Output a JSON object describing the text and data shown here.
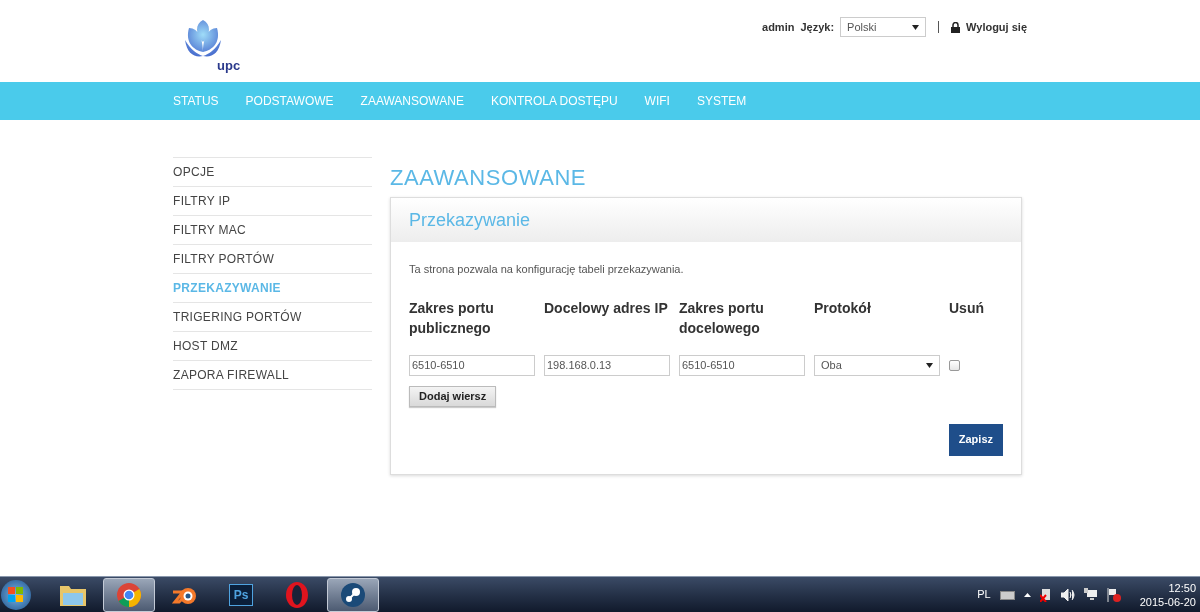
{
  "header": {
    "logo_text": "upc",
    "user": "admin",
    "language_label": "Język:",
    "language_select": {
      "value": "Polski"
    },
    "logout": "Wyloguj się"
  },
  "nav": [
    {
      "label": "STATUS",
      "selected": false
    },
    {
      "label": "PODSTAWOWE",
      "selected": false
    },
    {
      "label": "ZAAWANSOWANE",
      "selected": false
    },
    {
      "label": "KONTROLA DOSTĘPU",
      "selected": false
    },
    {
      "label": "WIFI",
      "selected": false
    },
    {
      "label": "SYSTEM",
      "selected": false
    }
  ],
  "sidebar": [
    {
      "label": "OPCJE",
      "selected": false
    },
    {
      "label": "FILTRY IP",
      "selected": false
    },
    {
      "label": "FILTRY MAC",
      "selected": false
    },
    {
      "label": "FILTRY PORTÓW",
      "selected": false
    },
    {
      "label": "PRZEKAZYWANIE",
      "selected": true
    },
    {
      "label": "TRIGERING PORTÓW",
      "selected": false
    },
    {
      "label": "HOST DMZ",
      "selected": false
    },
    {
      "label": "ZAPORA FIREWALL",
      "selected": false
    }
  ],
  "page_title": "ZAAWANSOWANE",
  "card": {
    "title": "Przekazywanie",
    "description": "Ta strona pozwala na konfigurację tabeli przekazywania.",
    "columns": [
      "Zakres portu publicznego",
      "Docelowy adres IP",
      "Zakres portu docelowego",
      "Protokół",
      "Usuń"
    ],
    "rows": [
      {
        "public_range": "6510-6510",
        "ip": "198.168.0.13",
        "target_range": "6510-6510",
        "protocol": "Oba",
        "checked": false
      }
    ],
    "add_button": "Dodaj wiersz",
    "save_button": "Zapisz"
  },
  "taskbar": {
    "apps": [
      {
        "kind": "folder",
        "selected": false
      },
      {
        "kind": "chrome",
        "selected": true
      },
      {
        "kind": "blender",
        "selected": false
      },
      {
        "kind": "ps",
        "label": "Ps",
        "selected": false
      },
      {
        "kind": "opera",
        "selected": false
      },
      {
        "kind": "steam",
        "selected": true
      }
    ],
    "language": "PL",
    "time": "12:50",
    "date": "2015-06-20"
  }
}
